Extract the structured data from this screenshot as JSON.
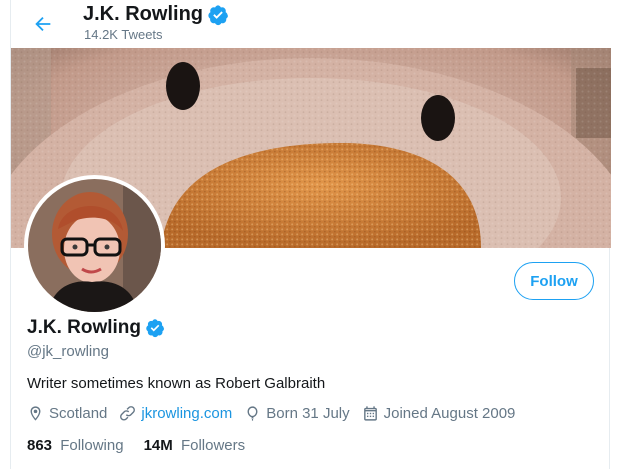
{
  "header": {
    "back_icon": "arrow-left-icon",
    "title": "J.K. Rowling",
    "tweet_count": "14.2K Tweets",
    "verified_icon": "verified-badge-icon"
  },
  "banner": {
    "icon": "plush-toy-banner-image"
  },
  "profile": {
    "avatar_icon": "profile-photo",
    "follow_label": "Follow",
    "display_name": "J.K. Rowling",
    "handle": "@jk_rowling",
    "bio": "Writer sometimes known as Robert Galbraith",
    "location": "Scotland",
    "website": "jkrowling.com",
    "birthday": "Born 31 July",
    "joined": "Joined August 2009"
  },
  "stats": {
    "following_count": "863",
    "following_label": "Following",
    "followers_count": "14M",
    "followers_label": "Followers"
  },
  "colors": {
    "accent": "#1da1f2",
    "link": "#1b95e0",
    "muted": "#657786",
    "text": "#14171a"
  }
}
